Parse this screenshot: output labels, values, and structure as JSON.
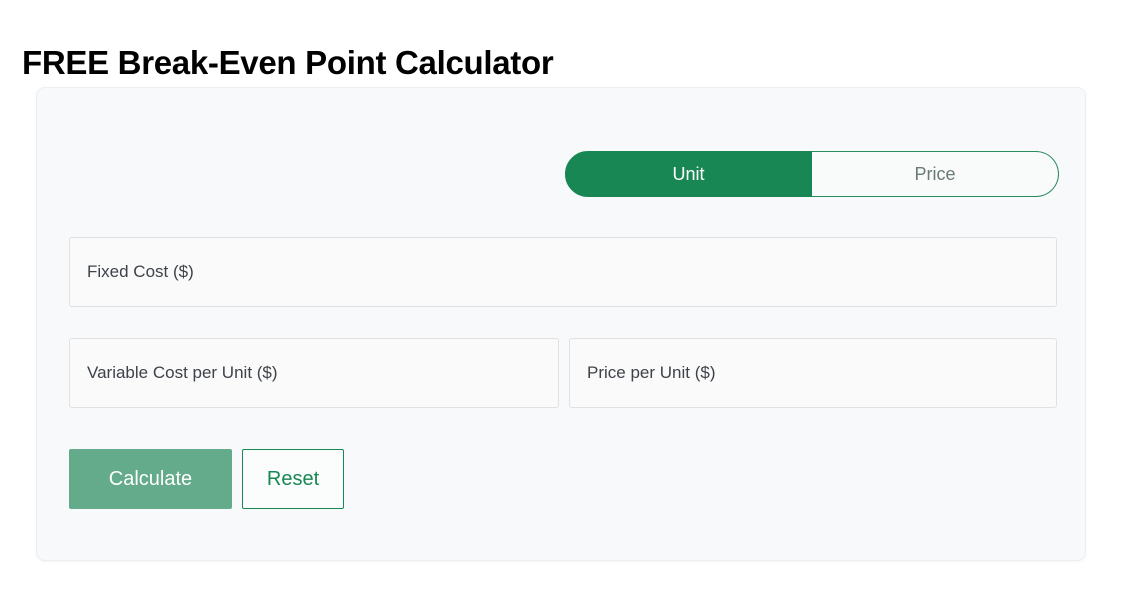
{
  "page": {
    "title": "FREE Break-Even Point Calculator",
    "background_color": "#ffffff"
  },
  "card": {
    "background_color": "#f8f9fa",
    "border_color": "#eceef0"
  },
  "mode_toggle": {
    "name": "calculation-mode",
    "selected": "Unit",
    "active_color": "#198754",
    "inactive_text_color": "#6a7b74",
    "options": [
      {
        "label": "Unit",
        "value": "unit",
        "active": true
      },
      {
        "label": "Price",
        "value": "price",
        "active": false
      }
    ]
  },
  "form": {
    "fixed_cost": {
      "label": "Fixed Cost ($)",
      "placeholder": "Fixed Cost ($)",
      "value": ""
    },
    "variable_cost_per_unit": {
      "label": "Variable Cost per Unit ($)",
      "placeholder": "Variable Cost per Unit ($)",
      "value": ""
    },
    "price_per_unit": {
      "label": "Price per Unit ($)",
      "placeholder": "Price per Unit ($)",
      "value": ""
    }
  },
  "actions": {
    "calculate_label": "Calculate",
    "calculate_color": "#63ab8a",
    "reset_label": "Reset",
    "reset_color": "#198754"
  }
}
